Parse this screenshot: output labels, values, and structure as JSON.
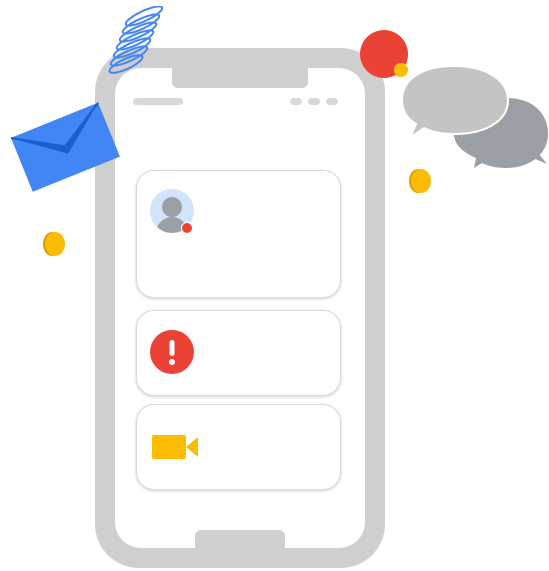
{
  "illustration": {
    "colors": {
      "phone_frame": "#cfcfcf",
      "screen": "#ffffff",
      "accent_blue": "#4285f4",
      "accent_red": "#ea4335",
      "accent_yellow": "#fbbc04",
      "bubble_light": "#c4c4c4",
      "bubble_dark": "#9aa0a6",
      "avatar_bg": "#d2e3fc"
    },
    "icons": [
      "spring-icon",
      "envelope-icon",
      "chat-bubbles-icon",
      "profile-avatar-icon",
      "alert-exclamation-icon",
      "video-camera-icon",
      "coin-icon"
    ]
  }
}
